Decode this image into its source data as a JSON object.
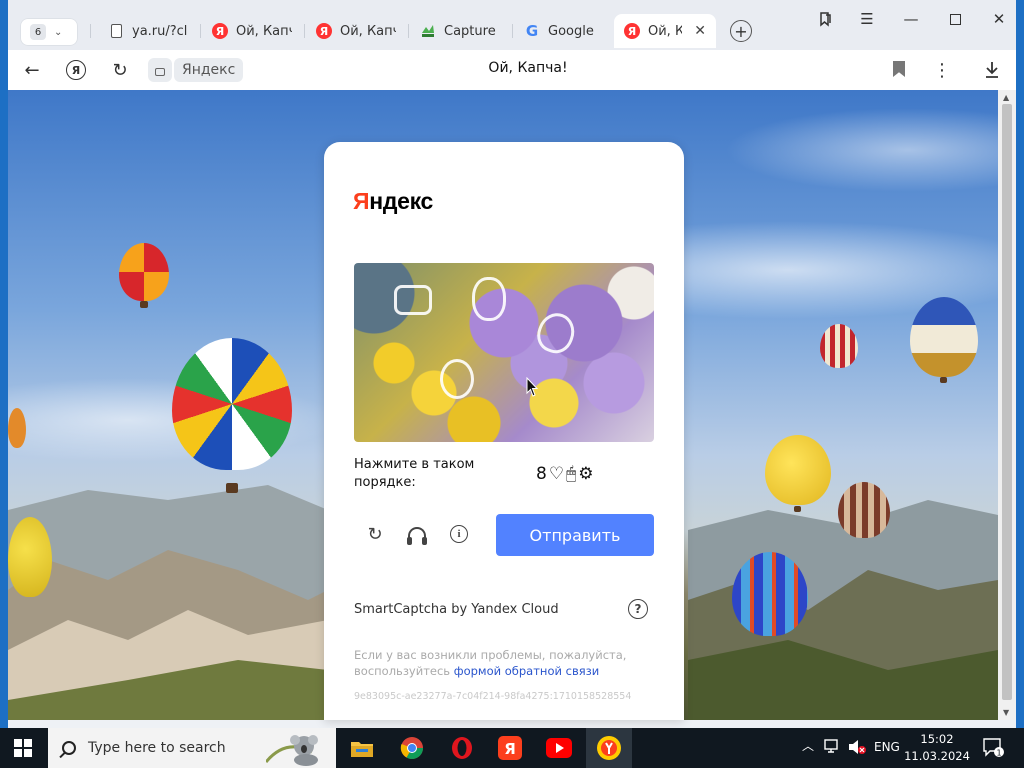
{
  "browser": {
    "tab_count": "6",
    "tabs": [
      {
        "label": "ya.ru/?clid",
        "icon": "document-icon",
        "active": false
      },
      {
        "label": "Ой, Капча",
        "icon": "yandex-icon",
        "active": false
      },
      {
        "label": "Ой, Капча",
        "icon": "yandex-icon",
        "active": false
      },
      {
        "label": "Capture th",
        "icon": "capture-icon",
        "active": false
      },
      {
        "label": "Google",
        "icon": "google-icon",
        "active": false
      },
      {
        "label": "Ой, Кап",
        "icon": "yandex-icon",
        "active": true
      }
    ],
    "site_chip": "Яндекс",
    "page_title": "Ой, Капча!",
    "ya_button": "Я"
  },
  "captcha": {
    "brand_first": "Я",
    "brand_rest": "ндекс",
    "instruction": "Нажмите в таком порядке:",
    "order_symbols": [
      "8",
      "♡",
      "🖱",
      "⚙"
    ],
    "submit_label": "Отправить",
    "provider": "SmartCaptcha by Yandex Cloud",
    "problem_text": "Если у вас возникли проблемы, пожалуйста, воспользуйтесь ",
    "problem_link": "формой обратной связи",
    "token": "9e83095c-ae23277a-7c04f214-98fa4275:1710158528554",
    "accent_color": "#5282ff",
    "brand_color": "#fc3f1d"
  },
  "taskbar": {
    "search_placeholder": "Type here to search",
    "language": "ENG",
    "time": "15:02",
    "date": "11.03.2024",
    "notification_count": "1",
    "apps": [
      "file-explorer-icon",
      "chrome-icon",
      "opera-icon",
      "yandex-icon",
      "youtube-icon",
      "yandex-browser-icon"
    ]
  }
}
